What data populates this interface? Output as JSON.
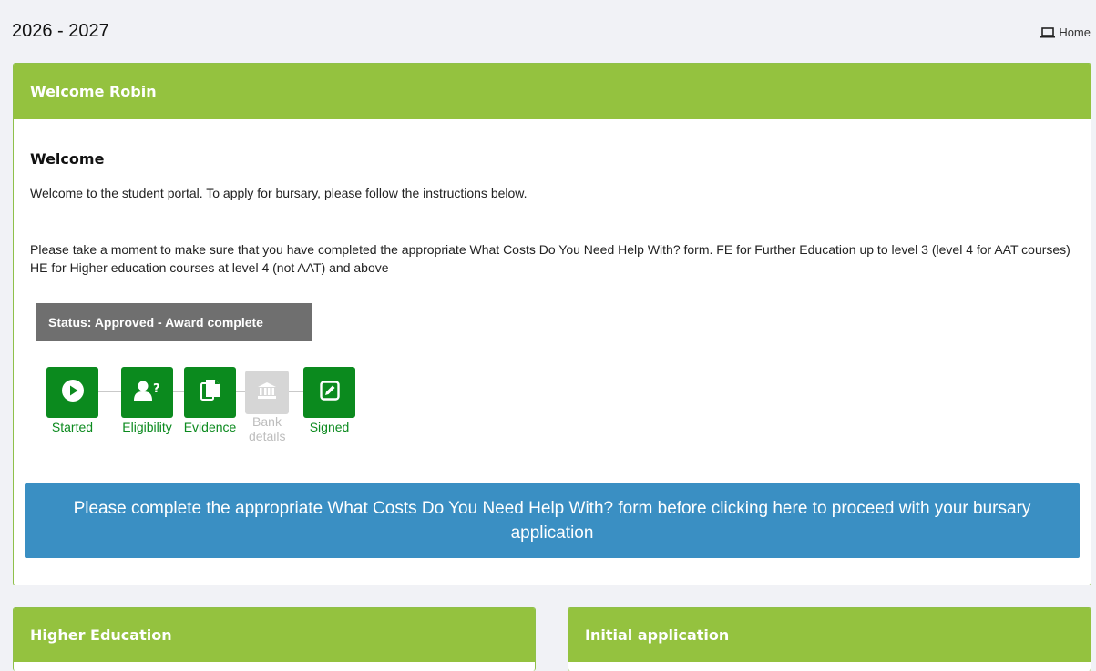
{
  "topbar": {
    "year_range": "2026 - 2027",
    "home_label": "Home",
    "home_icon": "laptop-icon"
  },
  "welcome_card": {
    "header": "Welcome Robin",
    "section_title": "Welcome",
    "intro": "Welcome to the student portal. To apply for bursary, please follow the instructions below.",
    "instructions": "Please take a moment to make sure that you have completed the appropriate What Costs Do You Need Help With? form. FE for Further Education up to level 3 (level 4 for AAT courses) HE for Higher education courses at level 4 (not AAT) and above",
    "status": "Status: Approved - Award complete",
    "steps": [
      {
        "label": "Started",
        "icon": "play-icon",
        "state": "complete"
      },
      {
        "label": "Eligibility",
        "icon": "user-question-icon",
        "state": "complete"
      },
      {
        "label": "Evidence",
        "icon": "documents-icon",
        "state": "complete"
      },
      {
        "label": "Bank details",
        "icon": "bank-icon",
        "state": "disabled"
      },
      {
        "label": "Signed",
        "icon": "signature-icon",
        "state": "complete"
      }
    ],
    "proceed_button": "Please complete the appropriate What Costs Do You Need Help With? form before clicking here to proceed with your bursary application"
  },
  "cards": {
    "higher_education": "Higher Education",
    "initial_application": "Initial application"
  },
  "colors": {
    "header_green": "#94c23f",
    "step_green": "#0b8a1e",
    "button_blue": "#3a8fc3",
    "status_gray": "#6f6f6f"
  }
}
